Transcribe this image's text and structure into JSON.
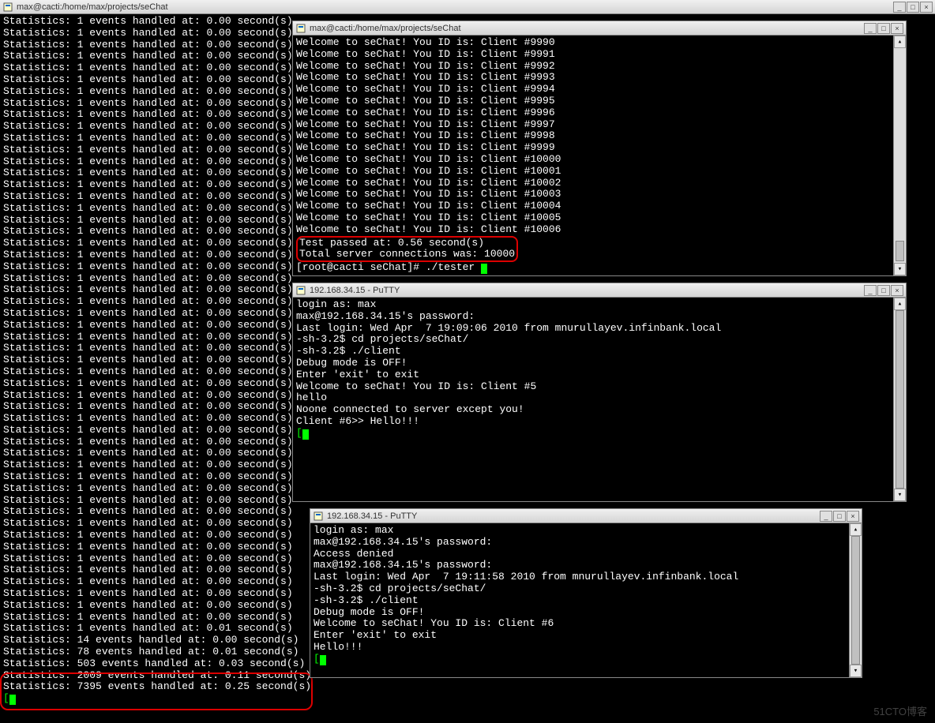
{
  "main_window": {
    "title": "max@cacti:/home/max/projects/seChat",
    "stats_normal": [
      {
        "events": 1,
        "time": "0.00"
      },
      {
        "events": 1,
        "time": "0.00"
      },
      {
        "events": 1,
        "time": "0.00"
      },
      {
        "events": 1,
        "time": "0.00"
      },
      {
        "events": 1,
        "time": "0.00"
      },
      {
        "events": 1,
        "time": "0.00"
      },
      {
        "events": 1,
        "time": "0.00"
      },
      {
        "events": 1,
        "time": "0.00"
      },
      {
        "events": 1,
        "time": "0.00"
      },
      {
        "events": 1,
        "time": "0.00"
      },
      {
        "events": 1,
        "time": "0.00"
      },
      {
        "events": 1,
        "time": "0.00"
      },
      {
        "events": 1,
        "time": "0.00"
      },
      {
        "events": 1,
        "time": "0.00"
      },
      {
        "events": 1,
        "time": "0.00"
      },
      {
        "events": 1,
        "time": "0.00"
      },
      {
        "events": 1,
        "time": "0.00"
      },
      {
        "events": 1,
        "time": "0.00"
      },
      {
        "events": 1,
        "time": "0.00"
      },
      {
        "events": 1,
        "time": "0.00"
      },
      {
        "events": 1,
        "time": "0.00"
      },
      {
        "events": 1,
        "time": "0.00"
      },
      {
        "events": 1,
        "time": "0.00"
      },
      {
        "events": 1,
        "time": "0.00"
      },
      {
        "events": 1,
        "time": "0.00"
      },
      {
        "events": 1,
        "time": "0.00"
      },
      {
        "events": 1,
        "time": "0.00"
      },
      {
        "events": 1,
        "time": "0.00"
      },
      {
        "events": 1,
        "time": "0.00"
      },
      {
        "events": 1,
        "time": "0.00"
      },
      {
        "events": 1,
        "time": "0.00"
      },
      {
        "events": 1,
        "time": "0.00"
      },
      {
        "events": 1,
        "time": "0.00"
      },
      {
        "events": 1,
        "time": "0.00"
      },
      {
        "events": 1,
        "time": "0.00"
      },
      {
        "events": 1,
        "time": "0.00"
      },
      {
        "events": 1,
        "time": "0.00"
      },
      {
        "events": 1,
        "time": "0.00"
      },
      {
        "events": 1,
        "time": "0.00"
      },
      {
        "events": 1,
        "time": "0.00"
      },
      {
        "events": 1,
        "time": "0.00"
      },
      {
        "events": 1,
        "time": "0.00"
      },
      {
        "events": 1,
        "time": "0.00"
      },
      {
        "events": 1,
        "time": "0.00"
      },
      {
        "events": 1,
        "time": "0.00"
      },
      {
        "events": 1,
        "time": "0.00"
      },
      {
        "events": 1,
        "time": "0.00"
      },
      {
        "events": 1,
        "time": "0.00"
      },
      {
        "events": 1,
        "time": "0.00"
      },
      {
        "events": 1,
        "time": "0.00"
      },
      {
        "events": 1,
        "time": "0.00"
      },
      {
        "events": 1,
        "time": "0.00"
      },
      {
        "events": 1,
        "time": "0.01"
      },
      {
        "events": 14,
        "time": "0.00"
      },
      {
        "events": 78,
        "time": "0.01"
      }
    ],
    "stats_highlighted": [
      {
        "events": 503,
        "time": "0.03"
      },
      {
        "events": 2009,
        "time": "0.11"
      },
      {
        "events": 7395,
        "time": "0.25"
      }
    ]
  },
  "window1": {
    "title": "max@cacti:/home/max/projects/seChat",
    "welcome_ids": [
      "9990",
      "9991",
      "9992",
      "9993",
      "9994",
      "9995",
      "9996",
      "9997",
      "9998",
      "9999",
      "10000",
      "10001",
      "10002",
      "10003",
      "10004",
      "10005",
      "10006"
    ],
    "test_passed": "Test passed at: 0.56 second(s)",
    "total_conn": "Total server connections was: 10000",
    "prompt": "[root@cacti seChat]# ./tester "
  },
  "window2": {
    "title": "192.168.34.15 - PuTTY",
    "lines": [
      "login as: max",
      "max@192.168.34.15's password:",
      "Last login: Wed Apr  7 19:09:06 2010 from mnurullayev.infinbank.local",
      "-sh-3.2$ cd projects/seChat/",
      "-sh-3.2$ ./client",
      "Debug mode is OFF!",
      "Enter 'exit' to exit",
      "Welcome to seChat! You ID is: Client #5",
      "hello",
      "Noone connected to server except you!",
      "Client #6>> Hello!!!"
    ]
  },
  "window3": {
    "title": "192.168.34.15 - PuTTY",
    "lines": [
      "login as: max",
      "max@192.168.34.15's password:",
      "Access denied",
      "max@192.168.34.15's password:",
      "Last login: Wed Apr  7 19:11:58 2010 from mnurullayev.infinbank.local",
      "-sh-3.2$ cd projects/seChat/",
      "-sh-3.2$ ./client",
      "Debug mode is OFF!",
      "Welcome to seChat! You ID is: Client #6",
      "Enter 'exit' to exit",
      "Hello!!!"
    ]
  },
  "stat_template": "Statistics: {e} events handled at: {t} second(s)",
  "welcome_template": "Welcome to seChat! You ID is: Client #{id}",
  "watermark": "51CTO博客"
}
